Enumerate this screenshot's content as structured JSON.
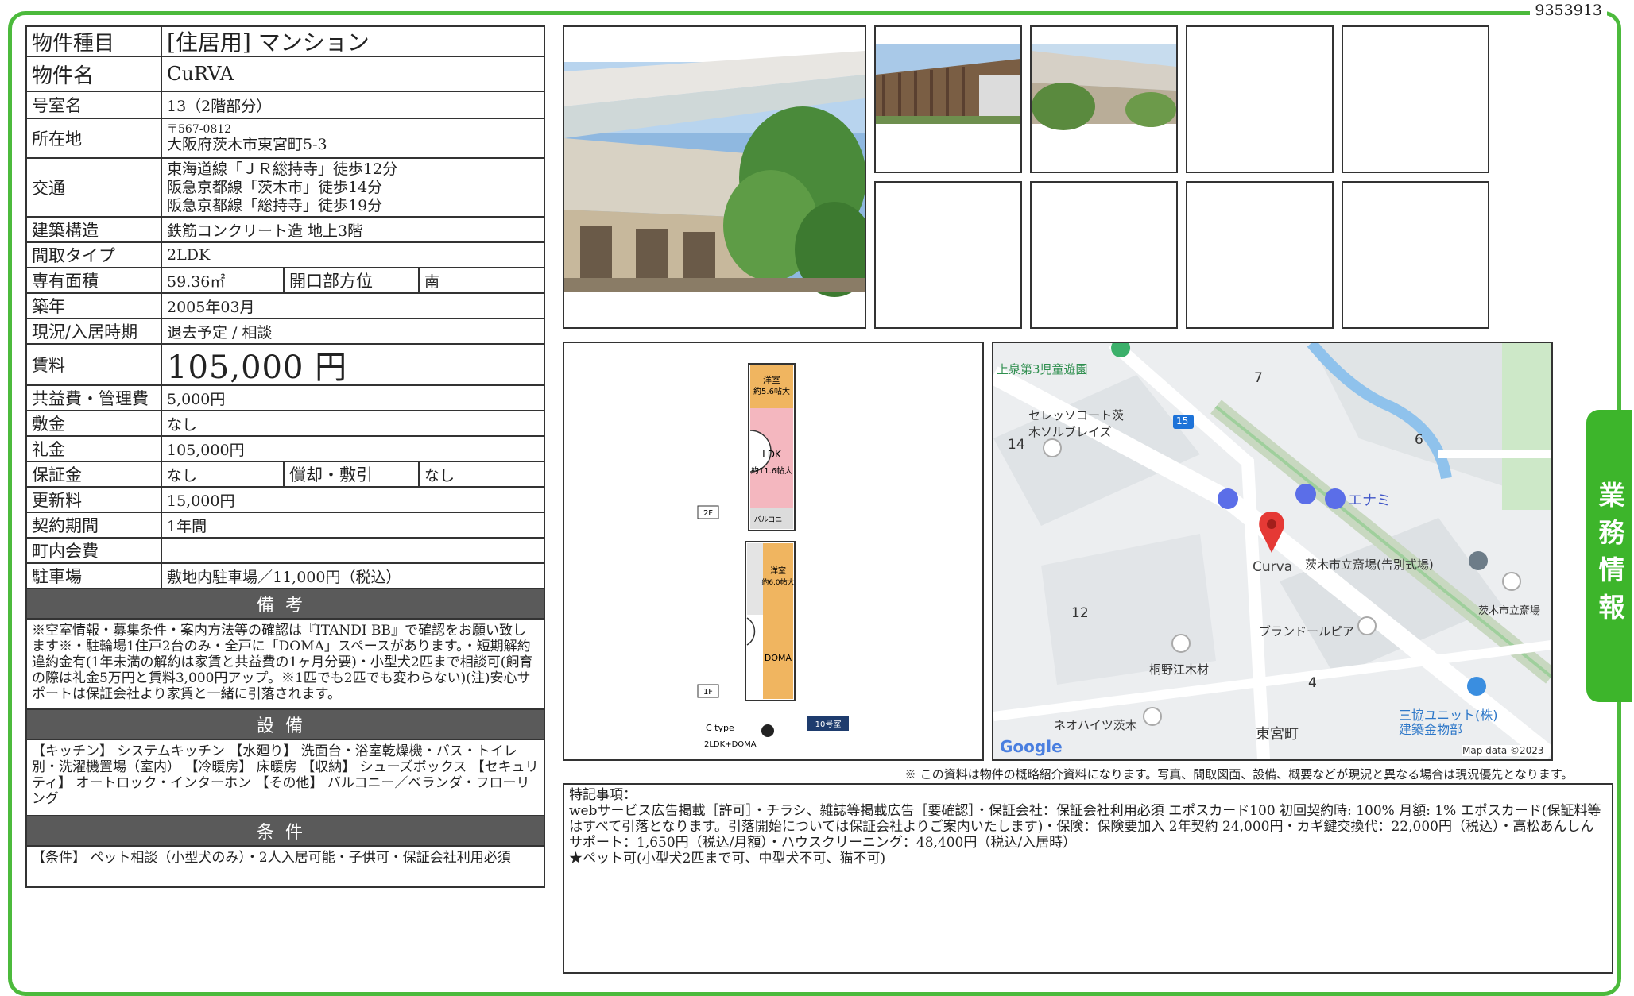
{
  "doc_id": "9353913",
  "side_tab": "業務情報",
  "property": {
    "type_label": "物件種目",
    "type_value": "[住居用] マンション",
    "name_label": "物件名",
    "name_value": "CuRVA",
    "room_label": "号室名",
    "room_value": "13（2階部分）",
    "address_label": "所在地",
    "postal": "〒567-0812",
    "address": "大阪府茨木市東宮町5-3",
    "access_label": "交通",
    "access": [
      "東海道線「ＪＲ総持寺」徒歩12分",
      "阪急京都線「茨木市」徒歩14分",
      "阪急京都線「総持寺」徒歩19分"
    ],
    "structure_label": "建築構造",
    "structure_value": "鉄筋コンクリート造 地上3階",
    "layout_label": "間取タイプ",
    "layout_value": "2LDK",
    "area_label": "専有面積",
    "area_value": "59.36㎡",
    "facing_label": "開口部方位",
    "facing_value": "南",
    "built_label": "築年",
    "built_value": "2005年03月",
    "status_label": "現況/入居時期",
    "status_value": "退去予定 / 相談",
    "rent_label": "賃料",
    "rent_value": "105,000 円",
    "fee_label": "共益費・管理費",
    "fee_value": "5,000円",
    "deposit_label": "敷金",
    "deposit_value": "なし",
    "key_label": "礼金",
    "key_value": "105,000円",
    "guarantee_label": "保証金",
    "guarantee_value": "なし",
    "amort_label": "償却・敷引",
    "amort_value": "なし",
    "renewal_label": "更新料",
    "renewal_value": "15,000円",
    "term_label": "契約期間",
    "term_value": "1年間",
    "town_label": "町内会費",
    "town_value": "",
    "parking_label": "駐車場",
    "parking_value": "敷地内駐車場／11,000円（税込）"
  },
  "remarks": {
    "head": "備考",
    "body": "※空室情報・募集条件・案内方法等の確認は『ITANDI BB』で確認をお願い致します※・駐輪場1住戸2台のみ・全戸に「DOMA」スペースがあります。・短期解約違約金有(1年未満の解約は家賃と共益費の1ヶ月分要)・小型犬2匹まで相談可(飼育の際は礼金5万円と賃料3,000円アップ。※1匹でも2匹でも変わらない)(注)安心サポートは保証会社より家賃と一緒に引落されます。"
  },
  "equipment": {
    "head": "設備",
    "body": "【キッチン】 システムキッチン 【水廻り】 洗面台・浴室乾燥機・バス・トイレ別・洗濯機置場（室内） 【冷暖房】 床暖房 【収納】 シューズボックス 【セキュリティ】 オートロック・インターホン 【その他】 バルコニー／ベランダ・フローリング"
  },
  "conditions": {
    "head": "条件",
    "body": "【条件】 ペット相談（小型犬のみ）・2人入居可能・子供可・保証会社利用必須"
  },
  "note": "※ この資料は物件の概略紹介資料になります。写真、間取図面、設備、概要などが現況と異なる場合は現況優先となります。",
  "special": {
    "head": "特記事項：",
    "line1": "webサービス広告掲載［許可］・チラシ、雑誌等掲載広告［要確認］・保証会社：保証会社利用必須 エポスカード100 初回契約時: 100% 月額: 1% エポスカード(保証料等はすべて引落となります。引落開始については保証会社よりご案内いたします)・保険：保険要加入 2年契約 24,000円・カギ鍵交換代：22,000円（税込）・高松あんしんサポート：1,650円（税込/月額）・ハウスクリーニング：48,400円（税込/入居時）",
    "line2": "★ペット可(小型犬2匹まで可、中型犬不可、猫不可)"
  },
  "floorplan": {
    "f2": "2F",
    "f1": "1F",
    "room_w1": "洋室",
    "room_w1_size": "約5.6帖大",
    "ldk": "LDK",
    "ldk_size": "約11.6帖大",
    "balcony": "バルコニー",
    "room_w2": "洋室",
    "room_w2_size": "約6.0帖大",
    "doma": "DOMA",
    "type_c": "C type",
    "type_detail": "2LDK+DOMA",
    "unit_badge": "10号室"
  },
  "map": {
    "park": "上泉第3児童遊園",
    "building1": "セレッソコート茨木ソルブレイズ",
    "route": "15",
    "shop": "エナミ",
    "target": "Curva",
    "hall": "茨木市立斎場(告別式場)",
    "hall2": "茨木市立斎場",
    "building2": "ブランドールピア",
    "wood": "桐野江木材",
    "heights": "ネオハイツ茨木",
    "town": "東宮町",
    "company": "三協ユニット(株) 建築金物部",
    "n7": "7",
    "n6": "6",
    "n14": "14",
    "n12": "12",
    "n4": "4",
    "google": "Google",
    "credit": "Map data ©2023"
  }
}
